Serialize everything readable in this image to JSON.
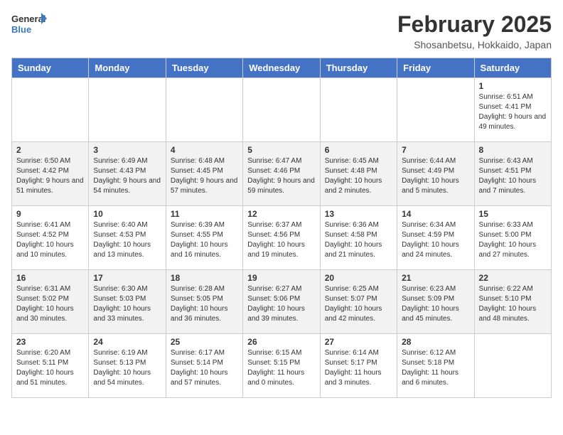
{
  "header": {
    "logo": {
      "general": "General",
      "blue": "Blue"
    },
    "title": "February 2025",
    "subtitle": "Shosanbetsu, Hokkaido, Japan"
  },
  "days_of_week": [
    "Sunday",
    "Monday",
    "Tuesday",
    "Wednesday",
    "Thursday",
    "Friday",
    "Saturday"
  ],
  "weeks": [
    [
      {
        "day": "",
        "info": ""
      },
      {
        "day": "",
        "info": ""
      },
      {
        "day": "",
        "info": ""
      },
      {
        "day": "",
        "info": ""
      },
      {
        "day": "",
        "info": ""
      },
      {
        "day": "",
        "info": ""
      },
      {
        "day": "1",
        "info": "Sunrise: 6:51 AM\nSunset: 4:41 PM\nDaylight: 9 hours and 49 minutes."
      }
    ],
    [
      {
        "day": "2",
        "info": "Sunrise: 6:50 AM\nSunset: 4:42 PM\nDaylight: 9 hours and 51 minutes."
      },
      {
        "day": "3",
        "info": "Sunrise: 6:49 AM\nSunset: 4:43 PM\nDaylight: 9 hours and 54 minutes."
      },
      {
        "day": "4",
        "info": "Sunrise: 6:48 AM\nSunset: 4:45 PM\nDaylight: 9 hours and 57 minutes."
      },
      {
        "day": "5",
        "info": "Sunrise: 6:47 AM\nSunset: 4:46 PM\nDaylight: 9 hours and 59 minutes."
      },
      {
        "day": "6",
        "info": "Sunrise: 6:45 AM\nSunset: 4:48 PM\nDaylight: 10 hours and 2 minutes."
      },
      {
        "day": "7",
        "info": "Sunrise: 6:44 AM\nSunset: 4:49 PM\nDaylight: 10 hours and 5 minutes."
      },
      {
        "day": "8",
        "info": "Sunrise: 6:43 AM\nSunset: 4:51 PM\nDaylight: 10 hours and 7 minutes."
      }
    ],
    [
      {
        "day": "9",
        "info": "Sunrise: 6:41 AM\nSunset: 4:52 PM\nDaylight: 10 hours and 10 minutes."
      },
      {
        "day": "10",
        "info": "Sunrise: 6:40 AM\nSunset: 4:53 PM\nDaylight: 10 hours and 13 minutes."
      },
      {
        "day": "11",
        "info": "Sunrise: 6:39 AM\nSunset: 4:55 PM\nDaylight: 10 hours and 16 minutes."
      },
      {
        "day": "12",
        "info": "Sunrise: 6:37 AM\nSunset: 4:56 PM\nDaylight: 10 hours and 19 minutes."
      },
      {
        "day": "13",
        "info": "Sunrise: 6:36 AM\nSunset: 4:58 PM\nDaylight: 10 hours and 21 minutes."
      },
      {
        "day": "14",
        "info": "Sunrise: 6:34 AM\nSunset: 4:59 PM\nDaylight: 10 hours and 24 minutes."
      },
      {
        "day": "15",
        "info": "Sunrise: 6:33 AM\nSunset: 5:00 PM\nDaylight: 10 hours and 27 minutes."
      }
    ],
    [
      {
        "day": "16",
        "info": "Sunrise: 6:31 AM\nSunset: 5:02 PM\nDaylight: 10 hours and 30 minutes."
      },
      {
        "day": "17",
        "info": "Sunrise: 6:30 AM\nSunset: 5:03 PM\nDaylight: 10 hours and 33 minutes."
      },
      {
        "day": "18",
        "info": "Sunrise: 6:28 AM\nSunset: 5:05 PM\nDaylight: 10 hours and 36 minutes."
      },
      {
        "day": "19",
        "info": "Sunrise: 6:27 AM\nSunset: 5:06 PM\nDaylight: 10 hours and 39 minutes."
      },
      {
        "day": "20",
        "info": "Sunrise: 6:25 AM\nSunset: 5:07 PM\nDaylight: 10 hours and 42 minutes."
      },
      {
        "day": "21",
        "info": "Sunrise: 6:23 AM\nSunset: 5:09 PM\nDaylight: 10 hours and 45 minutes."
      },
      {
        "day": "22",
        "info": "Sunrise: 6:22 AM\nSunset: 5:10 PM\nDaylight: 10 hours and 48 minutes."
      }
    ],
    [
      {
        "day": "23",
        "info": "Sunrise: 6:20 AM\nSunset: 5:11 PM\nDaylight: 10 hours and 51 minutes."
      },
      {
        "day": "24",
        "info": "Sunrise: 6:19 AM\nSunset: 5:13 PM\nDaylight: 10 hours and 54 minutes."
      },
      {
        "day": "25",
        "info": "Sunrise: 6:17 AM\nSunset: 5:14 PM\nDaylight: 10 hours and 57 minutes."
      },
      {
        "day": "26",
        "info": "Sunrise: 6:15 AM\nSunset: 5:15 PM\nDaylight: 11 hours and 0 minutes."
      },
      {
        "day": "27",
        "info": "Sunrise: 6:14 AM\nSunset: 5:17 PM\nDaylight: 11 hours and 3 minutes."
      },
      {
        "day": "28",
        "info": "Sunrise: 6:12 AM\nSunset: 5:18 PM\nDaylight: 11 hours and 6 minutes."
      },
      {
        "day": "",
        "info": ""
      }
    ]
  ]
}
